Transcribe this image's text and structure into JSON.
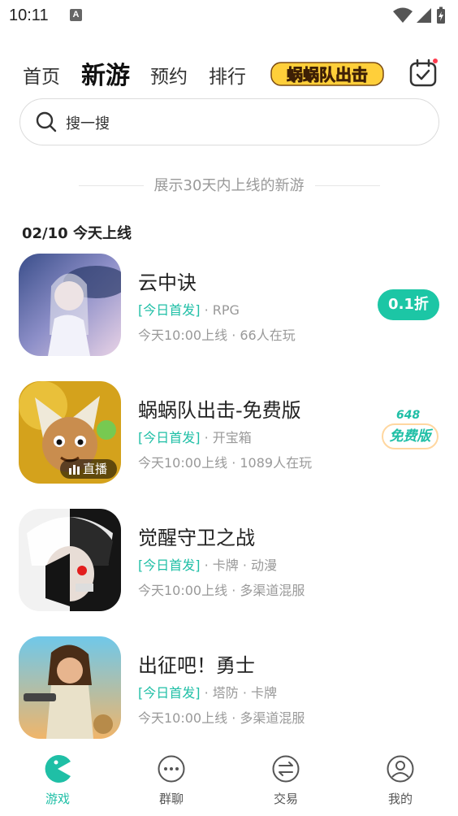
{
  "status_bar": {
    "time": "10:11",
    "notification_letter": "A"
  },
  "top_nav": {
    "tabs": [
      {
        "label": "首页",
        "active": false
      },
      {
        "label": "新游",
        "active": true
      },
      {
        "label": "预约",
        "active": false
      },
      {
        "label": "排行",
        "active": false
      }
    ],
    "banner_logo_text": "蜗蜗队出击",
    "calendar_icon": "calendar-check-icon"
  },
  "search": {
    "placeholder": "搜一搜"
  },
  "info_line": "展示30天内上线的新游",
  "date_header": "02/10 今天上线",
  "games": [
    {
      "name": "云中诀",
      "tag_highlight": "[今日首发]",
      "tags": "· RPG",
      "meta": "今天10:00上线 · 66人在玩",
      "badge": {
        "type": "discount",
        "text": "0.1折"
      }
    },
    {
      "name": "蜗蜗队出击-免费版",
      "tag_highlight": "[今日首发]",
      "tags": "· 开宝箱",
      "meta": "今天10:00上线 · 1089人在玩",
      "badge": {
        "type": "free",
        "top": "648",
        "text": "免费版"
      },
      "live": "直播"
    },
    {
      "name": "觉醒守卫之战",
      "tag_highlight": "[今日首发]",
      "tags": "· 卡牌 · 动漫",
      "meta": "今天10:00上线 · 多渠道混服"
    },
    {
      "name": "出征吧！勇士",
      "tag_highlight": "[今日首发]",
      "tags": "· 塔防 · 卡牌",
      "meta": "今天10:00上线 · 多渠道混服"
    }
  ],
  "bottom_nav": [
    {
      "label": "游戏",
      "icon": "game-pacman-icon",
      "active": true
    },
    {
      "label": "群聊",
      "icon": "chat-bubble-icon",
      "active": false
    },
    {
      "label": "交易",
      "icon": "exchange-icon",
      "active": false
    },
    {
      "label": "我的",
      "icon": "profile-icon",
      "active": false
    }
  ],
  "colors": {
    "accent": "#1fbfa6",
    "text_primary": "#222222",
    "text_secondary": "#999999"
  }
}
